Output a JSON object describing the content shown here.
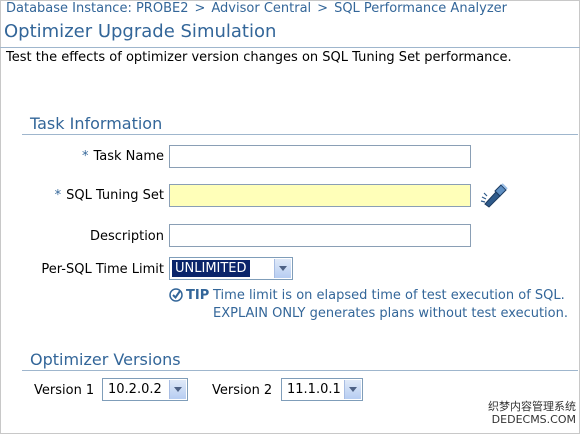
{
  "breadcrumb": {
    "items": [
      "Database Instance: PROBE2",
      "Advisor Central",
      "SQL Performance Analyzer"
    ],
    "separator": ">"
  },
  "page": {
    "title": "Optimizer Upgrade Simulation",
    "description": "Test the effects of optimizer version changes on SQL Tuning Set performance."
  },
  "task_info": {
    "section_title": "Task Information",
    "required_marker": "*",
    "task_name_label": "Task Name",
    "task_name_value": "",
    "sql_tuning_set_label": "SQL Tuning Set",
    "sql_tuning_set_value": "",
    "description_label": "Description",
    "description_value": "",
    "time_limit_label": "Per-SQL Time Limit",
    "time_limit_value": "UNLIMITED"
  },
  "tip": {
    "label": "TIP",
    "line1": "Time limit is on elapsed time of test execution of SQL.",
    "line2": "EXPLAIN ONLY generates plans without test execution."
  },
  "optimizer_versions": {
    "section_title": "Optimizer Versions",
    "version1_label": "Version 1",
    "version1_value": "10.2.0.2",
    "version2_label": "Version 2",
    "version2_value": "11.1.0.1"
  },
  "watermark": {
    "line1": "织梦内容管理系统",
    "line2": "DEDECMS.COM"
  },
  "colors": {
    "heading_blue": "#336699",
    "required_field_yellow": "#ffffb9",
    "selected_option_bg": "#0a246a"
  }
}
